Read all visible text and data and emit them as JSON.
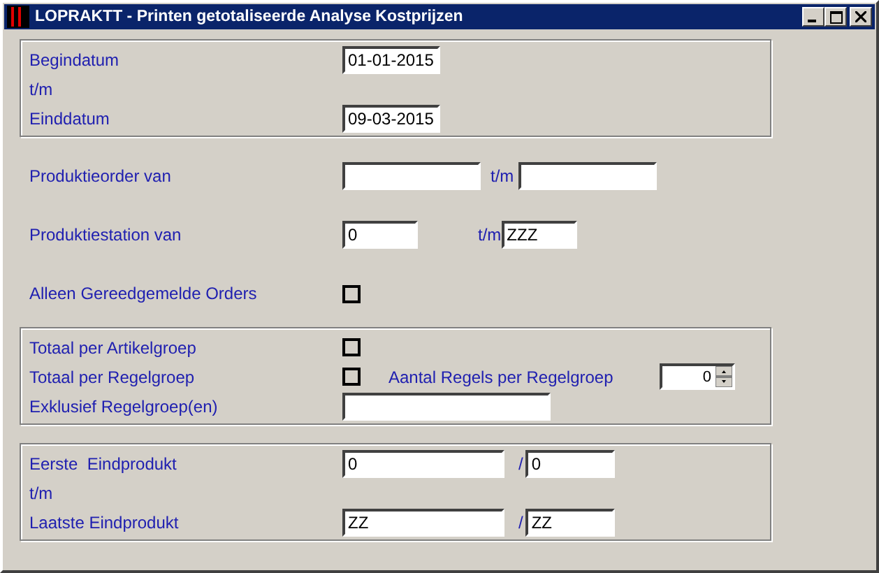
{
  "window": {
    "title": "LOPRAKTT - Printen getotaliseerde Analyse Kostprijzen"
  },
  "sections": [
    {
      "framed": true,
      "rows": [
        {
          "kind": "date",
          "label": "Begindatum",
          "value": "01-01-2015"
        },
        {
          "kind": "caption",
          "label": "t/m"
        },
        {
          "kind": "date",
          "label": "Einddatum",
          "value": "09-03-2015"
        }
      ]
    },
    {
      "framed": false,
      "rows": [
        {
          "kind": "range",
          "label": "Produktieorder van",
          "separator": "t/m"
        },
        {
          "kind": "station",
          "label": "Produktiestation van",
          "from": "0",
          "separator": "t/m",
          "to": "ZZZ"
        },
        {
          "kind": "check",
          "label": "Alleen Gereedgemelde Orders",
          "checked": false
        }
      ]
    },
    {
      "framed": true,
      "rows": [
        {
          "kind": "check",
          "label": "Totaal per Artikelgroep",
          "checked": false
        },
        {
          "kind": "check-count",
          "label": "Totaal per Regelgroep",
          "checked": false,
          "count_label": "Aantal Regels per Regelgroep",
          "count": "0"
        },
        {
          "kind": "text",
          "label": "Exklusief Regelgroep(en)"
        }
      ]
    },
    {
      "framed": true,
      "rows": [
        {
          "kind": "product",
          "label": "Eerste  Eindprodukt",
          "from": "0",
          "separator": "/",
          "to": "0"
        },
        {
          "kind": "caption",
          "label": "t/m"
        },
        {
          "kind": "product",
          "label": "Laatste Eindprodukt",
          "from": "ZZ",
          "separator": "/",
          "to": "ZZ"
        }
      ]
    }
  ]
}
